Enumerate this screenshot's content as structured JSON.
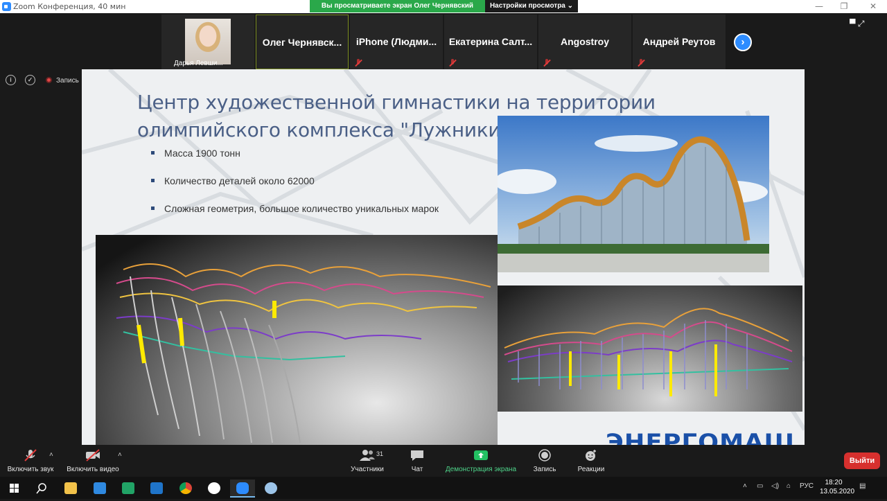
{
  "window": {
    "title": "Zoom Конференция, 40 мин",
    "share_banner": "Вы просматриваете экран Олег Чернявский",
    "view_settings": "Настройки просмотра ⌄",
    "controls": [
      "—",
      "❐",
      "✕"
    ]
  },
  "gallery": {
    "self_label": "Дарья Левши...",
    "tiles": [
      {
        "name": "Олег  Чернявск...",
        "muted": false,
        "active": true
      },
      {
        "name": "iPhone  (Людми...",
        "muted": true,
        "active": false
      },
      {
        "name": "Екатерина  Салт...",
        "muted": true,
        "active": false
      },
      {
        "name": "Angostroy",
        "muted": true,
        "active": false
      },
      {
        "name": "Андрей Реутов",
        "muted": true,
        "active": false
      }
    ],
    "next_glyph": "›",
    "view_icons": "▀  ⤢"
  },
  "status": {
    "info_glyph": "i",
    "shield_glyph": "✓",
    "recording_label": "Запись"
  },
  "slide": {
    "title_line1": "Центр художественной гимнастики на территории",
    "title_line2": "олимпийского комплекса \"Лужники\".",
    "bullets": [
      "Масса 1900 тонн",
      "Количество деталей около 62000",
      "Сложная геометрия,  большое количество уникальных марок"
    ],
    "logo": "ЭНЕРГОМАШ"
  },
  "toolbar": {
    "unmute": "Включить звук",
    "start_video": "Включить видео",
    "participants": "Участники",
    "participants_count": "31",
    "chat": "Чат",
    "share_screen": "Демонстрация экрана",
    "record": "Запись",
    "reactions": "Реакции",
    "leave": "Выйти",
    "caret": "˄"
  },
  "taskbar": {
    "language": "РУС",
    "time": "18:20",
    "date": "13.05.2020"
  },
  "colors": {
    "zoom_blue": "#2d8cff",
    "share_green": "#2aa84a",
    "leave_red": "#d7302e",
    "slide_title": "#4a5f86",
    "logo_blue": "#1a50a8"
  }
}
